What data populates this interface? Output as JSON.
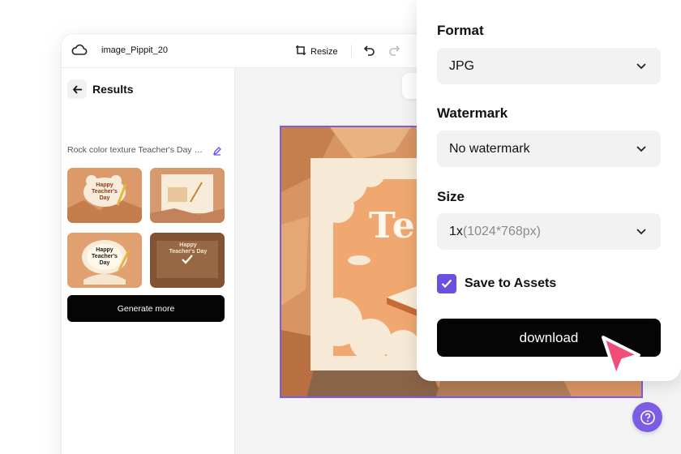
{
  "topbar": {
    "doc_title": "image_Pippit_20",
    "resize_label": "Resize"
  },
  "sidebar": {
    "title": "Results",
    "prompt": "Rock color texture Teacher's Day card",
    "thumbnails": [
      {
        "text": "Happy Teacher's Day",
        "selected": false
      },
      {
        "text": "",
        "selected": false
      },
      {
        "text": "Happy Teacher's Day",
        "selected": false
      },
      {
        "text": "Happy Teacher's Day",
        "selected": true
      }
    ],
    "generate_more_label": "Generate more"
  },
  "canvas": {
    "artwork_text": "Tea"
  },
  "download_panel": {
    "format_label": "Format",
    "format_value": "JPG",
    "watermark_label": "Watermark",
    "watermark_value": "No watermark",
    "size_label": "Size",
    "size_value_main": "1x",
    "size_value_detail": "(1024*768px)",
    "save_to_assets_label": "Save to Assets",
    "save_to_assets_checked": true,
    "download_label": "download"
  },
  "colors": {
    "accent": "#6a4fe0",
    "primary_button": "#050505",
    "cursor": "#f04e78"
  }
}
